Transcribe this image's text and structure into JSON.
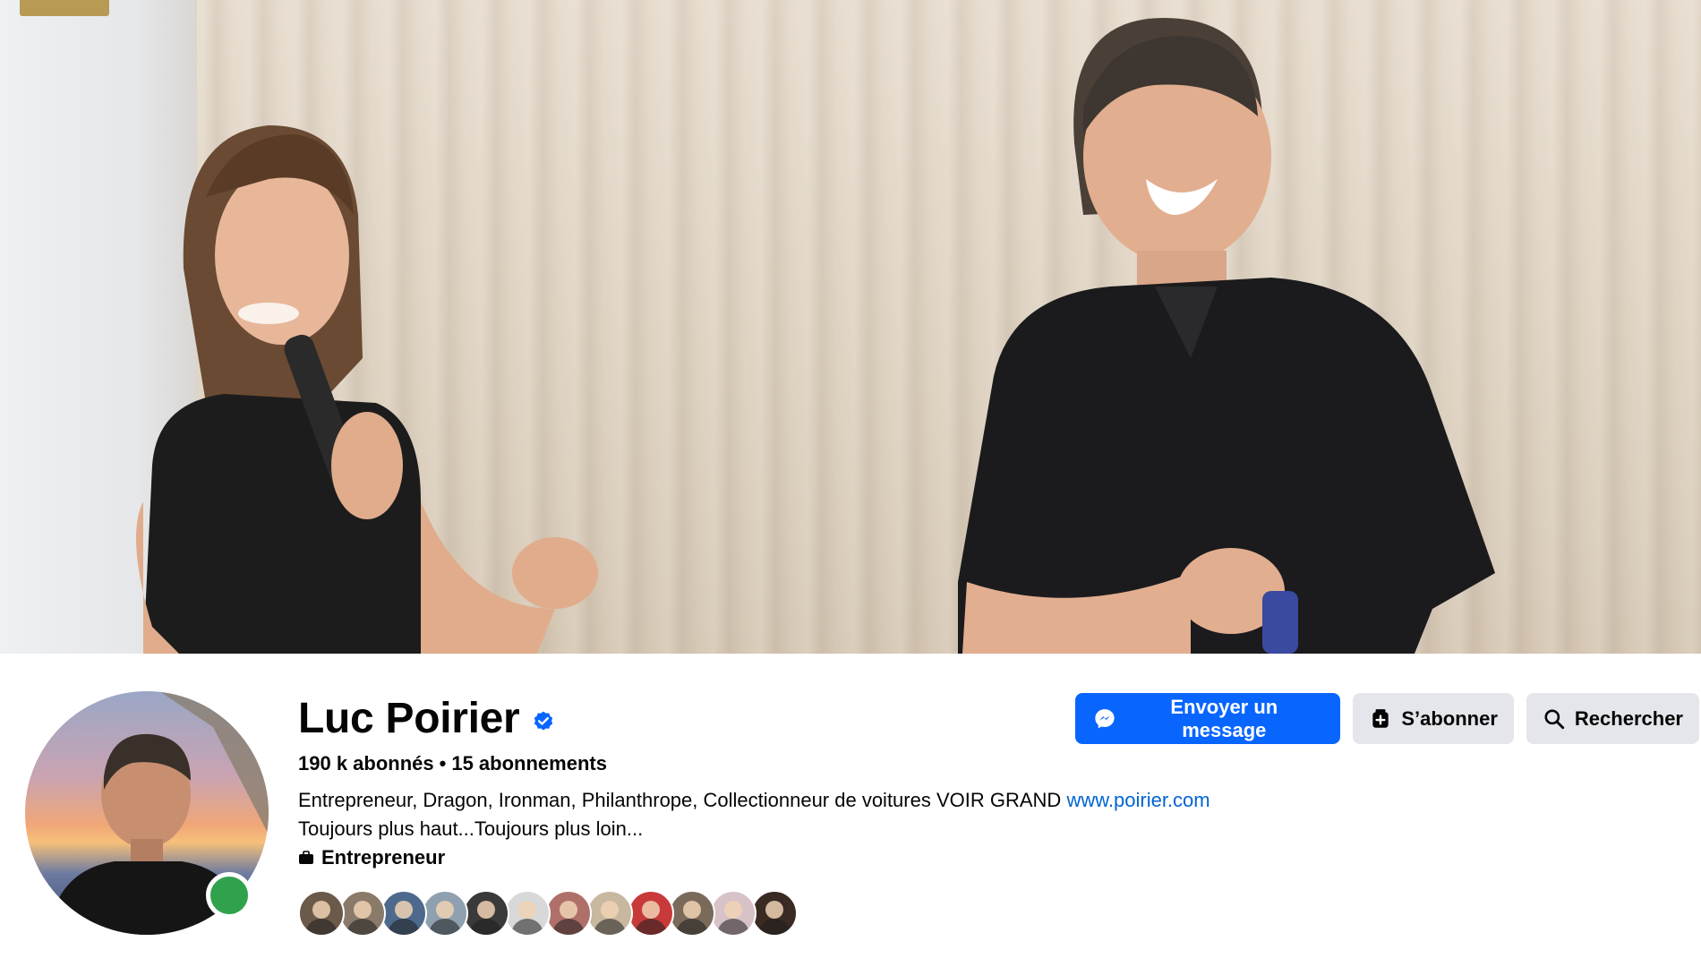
{
  "profile": {
    "name": "Luc Poirier",
    "followers": "190 k abonnés",
    "separator": "•",
    "following": "15 abonnements",
    "bio_text": "Entrepreneur, Dragon, Ironman, Philanthrope, Collectionneur de voitures VOIR GRAND",
    "bio_link": "www.poirier.com",
    "bio_line2": "Toujours plus haut...Toujours plus loin...",
    "category": "Entrepreneur"
  },
  "actions": {
    "message_label": "Envoyer un message",
    "subscribe_label": "S’abonner",
    "search_label": "Rechercher"
  },
  "colors": {
    "primary": "#0866ff",
    "secondary": "#e4e6eb",
    "link": "#0064d1",
    "online": "#31a24c",
    "verified": "#0866ff"
  },
  "icons": {
    "verified": "verified-badge-icon",
    "category": "briefcase-icon",
    "message": "messenger-icon",
    "subscribe": "add-follow-icon",
    "search": "magnifier-icon"
  },
  "friend_avatars": [
    {
      "color": "#6b5a4a"
    },
    {
      "color": "#8a7a6a"
    },
    {
      "color": "#4d6a8c"
    },
    {
      "color": "#8fa0b0"
    },
    {
      "color": "#3a3a3a"
    },
    {
      "color": "#d8d8d8"
    },
    {
      "color": "#b0706a"
    },
    {
      "color": "#c8b8a0"
    },
    {
      "color": "#c83a3a"
    },
    {
      "color": "#7a6a5a"
    },
    {
      "color": "#d7c2c8"
    },
    {
      "color": "#3a2a24"
    }
  ]
}
